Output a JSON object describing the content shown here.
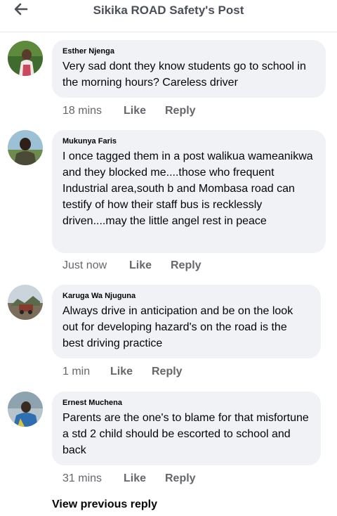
{
  "header": {
    "back_icon": "back-arrow-icon",
    "title": "Sikika ROAD Safety's Post"
  },
  "comments": [
    {
      "author": "Esther Njenga",
      "text": "Very sad dont they know students go to school in the morning hours? Careless driver",
      "time": "18 mins",
      "like": "Like",
      "reply": "Reply"
    },
    {
      "author": "Mukunya Faris",
      "text": "I once tagged them in a post walikua wameanikwa and they blocked me....those who frequent Industrial area,south b and Mombasa road can testify of how their staff bus is recklessly driven....may the little angel rest in peace",
      "time": "Just now",
      "like": "Like",
      "reply": "Reply"
    },
    {
      "author": "Karuga Wa Njuguna",
      "text": "Always drive in anticipation and be on the look out for developing hazard's on the road is the best driving practice",
      "time": "1 min",
      "like": "Like",
      "reply": "Reply"
    },
    {
      "author": "Ernest Muchena",
      "text": "Parents are the one's to blame for that misfortune a std 2 child should be escorted to school and back",
      "time": "31 mins",
      "like": "Like",
      "reply": "Reply"
    }
  ],
  "footer": {
    "view_previous": "View previous reply"
  }
}
